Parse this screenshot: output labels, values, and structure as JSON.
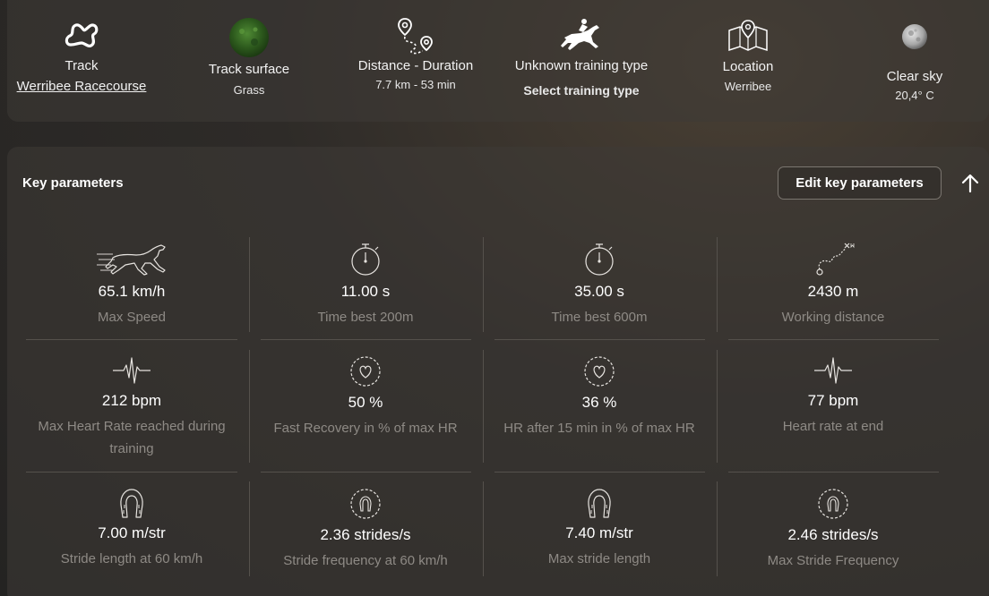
{
  "info_bar": {
    "track": {
      "label": "Track",
      "value": "Werribee Racecourse",
      "icon": "track-icon"
    },
    "surface": {
      "label": "Track surface",
      "value": "Grass",
      "icon": "grass-icon"
    },
    "distance": {
      "label": "Distance - Duration",
      "value": "7.7 km - 53 min",
      "icon": "route-icon"
    },
    "training": {
      "label": "Unknown training type",
      "value": "Select training type",
      "icon": "jockey-icon"
    },
    "location": {
      "label": "Location",
      "value": "Werribee",
      "icon": "map-icon"
    },
    "weather": {
      "label": "Clear sky",
      "value": "20,4° C",
      "icon": "moon-icon"
    }
  },
  "key_parameters": {
    "title": "Key parameters",
    "edit_label": "Edit key parameters",
    "metrics": [
      {
        "value": "65.1 km/h",
        "label": "Max Speed",
        "icon": "running-horse-icon"
      },
      {
        "value": "11.00 s",
        "label": "Time best 200m",
        "icon": "stopwatch-icon"
      },
      {
        "value": "35.00 s",
        "label": "Time best 600m",
        "icon": "stopwatch-icon"
      },
      {
        "value": "2430 m",
        "label": "Working distance",
        "icon": "distance-path-icon"
      },
      {
        "value": "212 bpm",
        "label": "Max Heart Rate reached during training",
        "icon": "heartbeat-icon"
      },
      {
        "value": "50 %",
        "label": "Fast Recovery in % of max HR",
        "icon": "heart-recovery-icon"
      },
      {
        "value": "36 %",
        "label": "HR after 15 min in % of max HR",
        "icon": "heart-recovery-icon"
      },
      {
        "value": "77 bpm",
        "label": "Heart rate at end",
        "icon": "heartbeat-icon"
      },
      {
        "value": "7.00 m/str",
        "label": "Stride length at 60 km/h",
        "icon": "horseshoe-icon"
      },
      {
        "value": "2.36 strides/s",
        "label": "Stride frequency at 60 km/h",
        "icon": "horseshoe-cycle-icon"
      },
      {
        "value": "7.40 m/str",
        "label": "Max stride length",
        "icon": "horseshoe-icon"
      },
      {
        "value": "2.46 strides/s",
        "label": "Max Stride Frequency",
        "icon": "horseshoe-cycle-icon"
      }
    ]
  }
}
